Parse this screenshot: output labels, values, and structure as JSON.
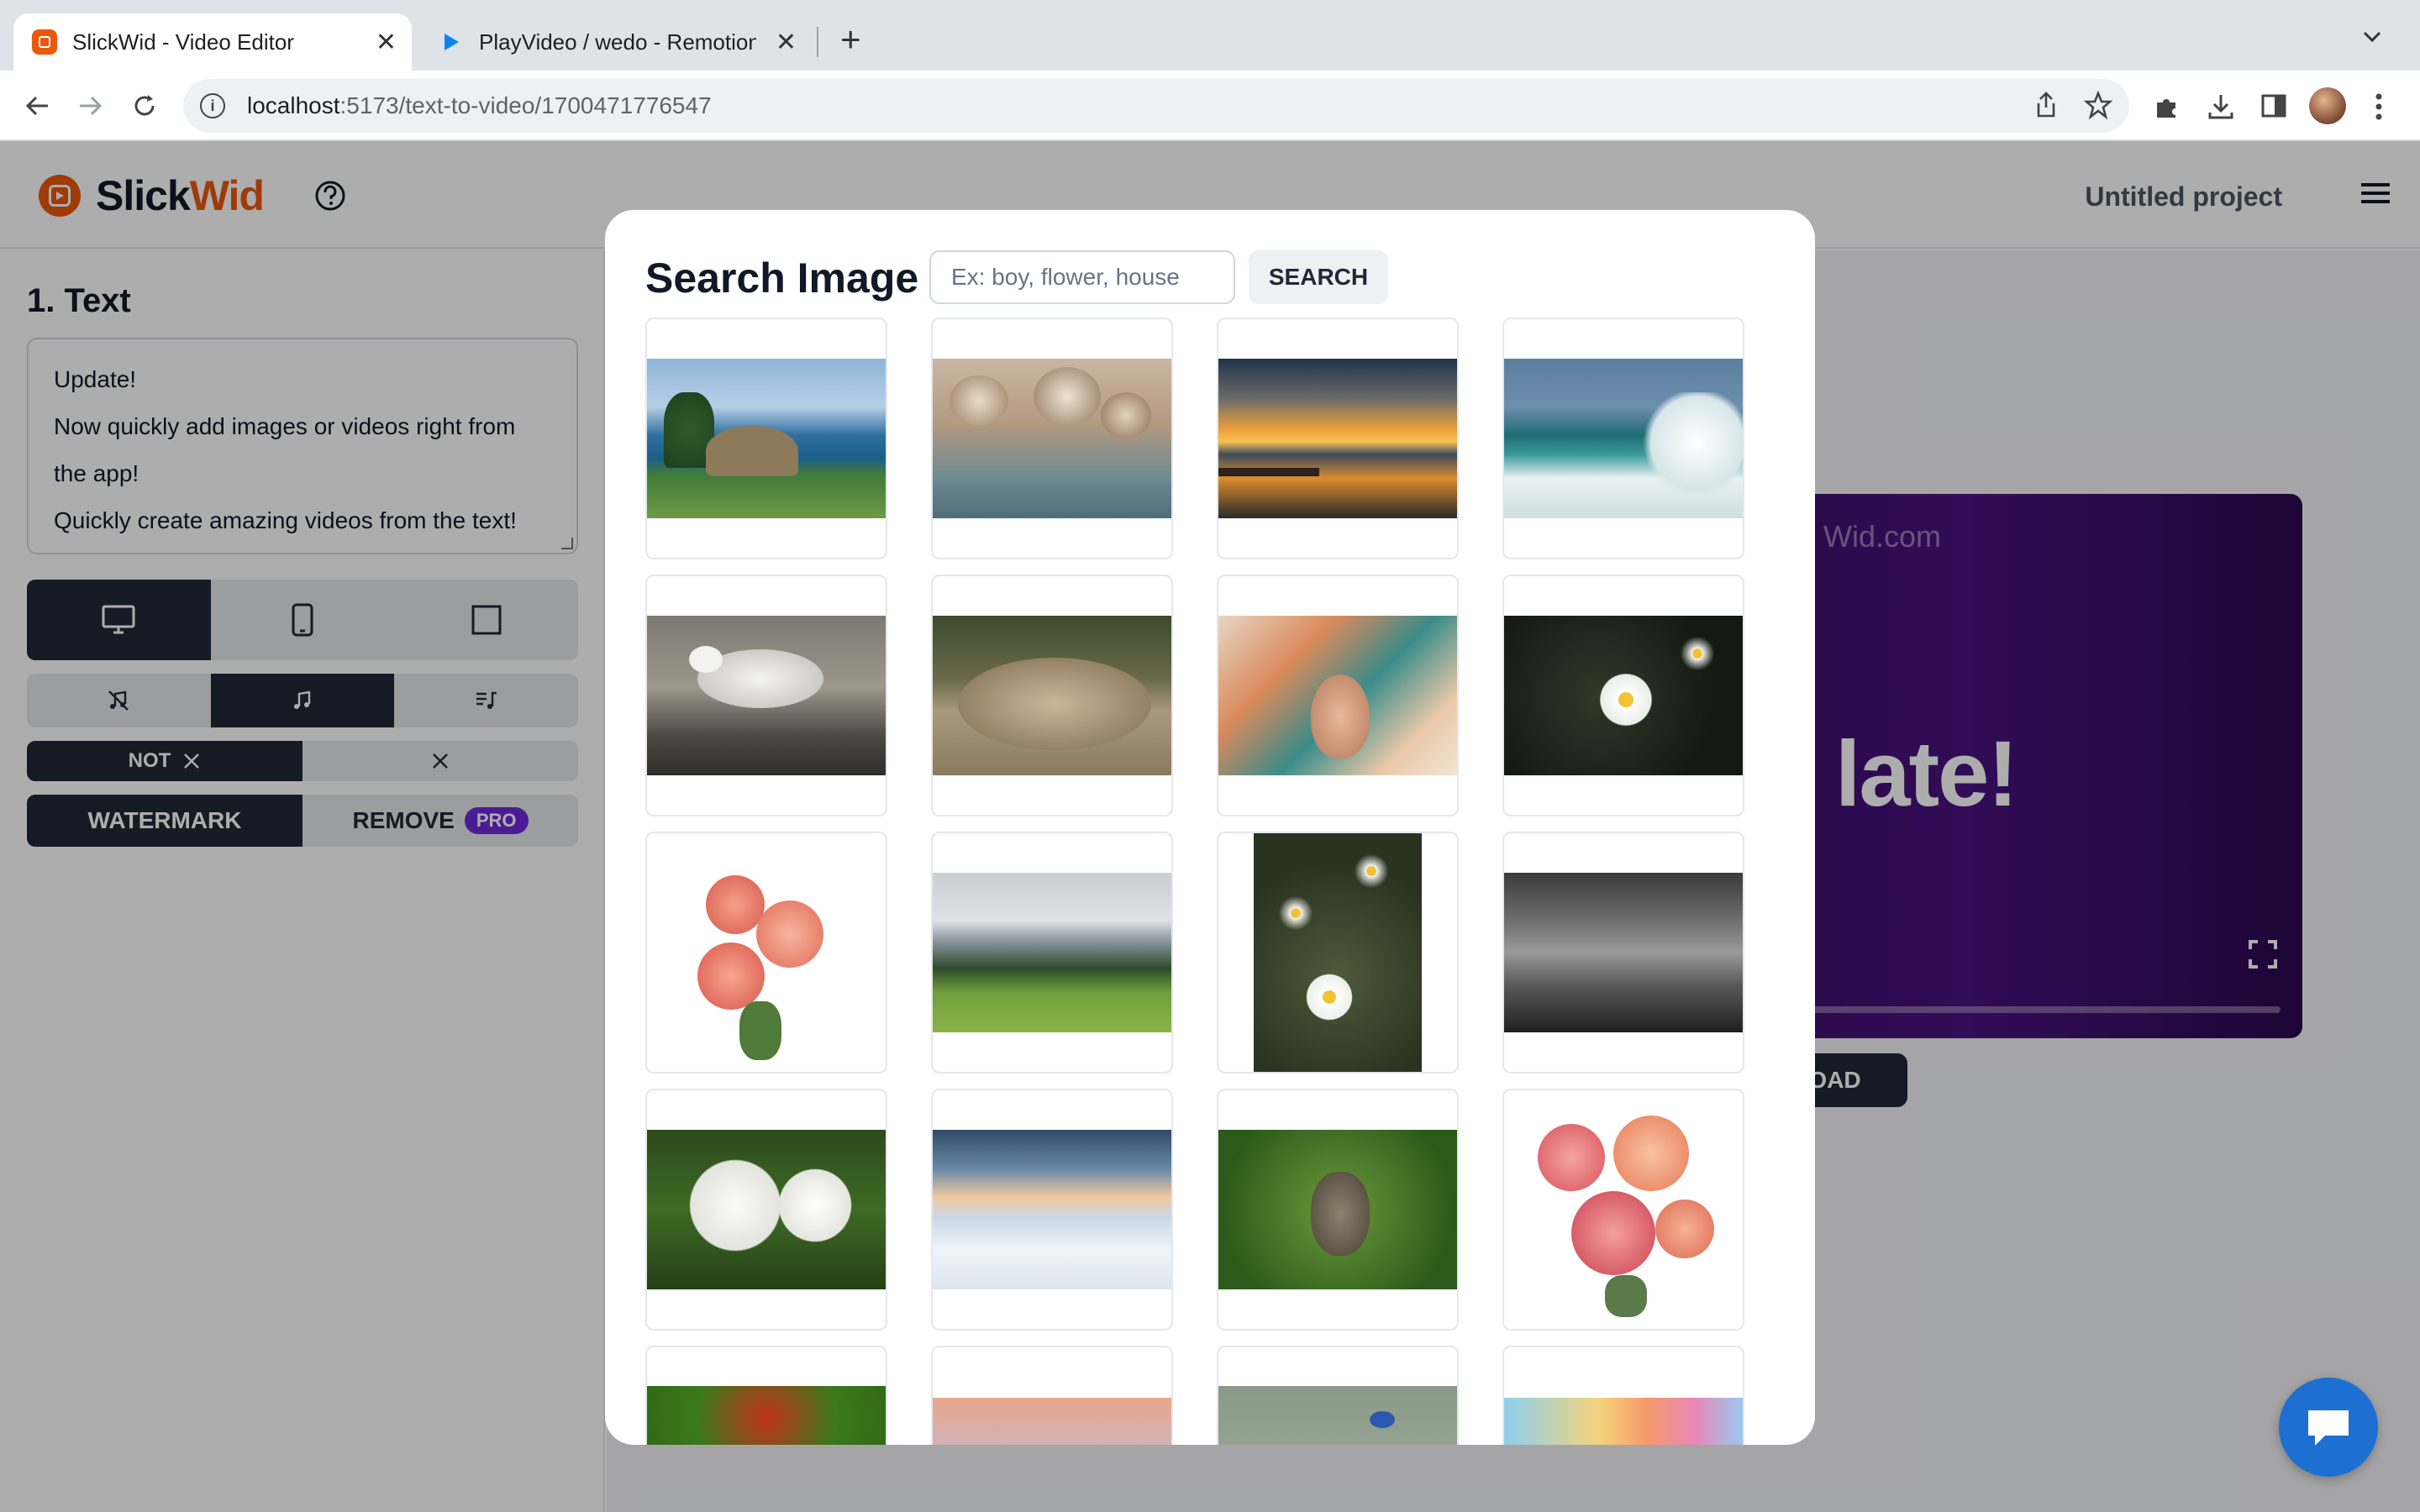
{
  "browser": {
    "tabs": [
      {
        "title": "SlickWid - Video Editor",
        "active": true
      },
      {
        "title": "PlayVideo / wedo - Remotion S",
        "active": false
      }
    ],
    "url_host": "localhost",
    "url_path": ":5173/text-to-video/1700471776547"
  },
  "app": {
    "logo_part1": "Slick",
    "logo_part2": "Wid",
    "project_title": "Untitled project",
    "brand_color": "#ea580c"
  },
  "sidebar": {
    "section_title": "1. Text",
    "text_lines": [
      "Update!",
      "Now quickly add images or videos right from",
      "the app!",
      "Quickly create amazing videos from the text!"
    ],
    "x_not_label": "NOT",
    "watermark_label": "WATERMARK",
    "remove_label": "REMOVE",
    "pro_label": "PRO"
  },
  "preview": {
    "watermark": "Wid.com",
    "headline": "late!",
    "download_label": "LOAD"
  },
  "modal": {
    "title": "Search Image",
    "search_placeholder": "Ex: boy, flower, house",
    "search_button": "SEARCH",
    "images": [
      "coastal-island",
      "dried-flowers",
      "sunset-pier",
      "ocean-wave",
      "seagull",
      "resting-duck",
      "floral-woman-portrait",
      "daisy",
      "rose-bouquet",
      "alpine-meadow",
      "daisies-vertical",
      "stormy-sky",
      "white-flowers",
      "snowy-landscape",
      "owl",
      "rose-bouquet-watercolor",
      "red-flower",
      "winter-sunset",
      "bird-on-branch",
      "rainbow-clouds"
    ]
  }
}
